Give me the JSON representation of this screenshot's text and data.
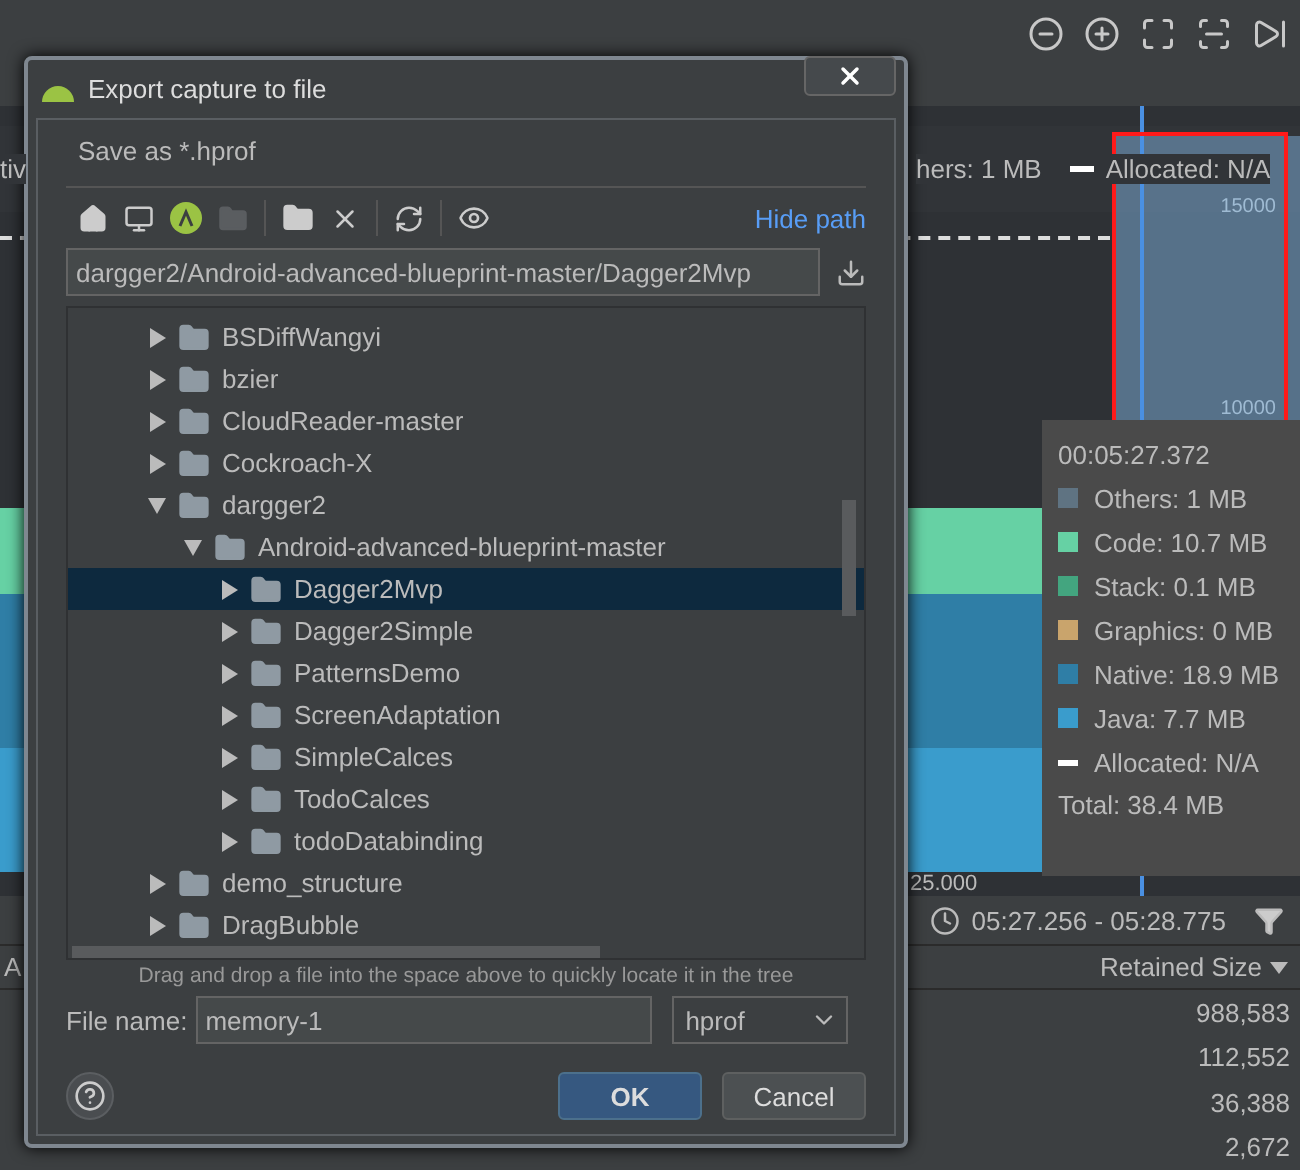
{
  "chart": {
    "legend": [
      "tiv",
      "hers: 1 MB",
      "Allocated: N/A"
    ],
    "y_labels": [
      "15000",
      "10000"
    ],
    "x_label": "25.000"
  },
  "tooltip": {
    "time": "00:05:27.372",
    "items": [
      {
        "label": "Others: 1 MB",
        "color": "#5f7382",
        "kind": "box"
      },
      {
        "label": "Code: 10.7 MB",
        "color": "#66d1a4",
        "kind": "box"
      },
      {
        "label": "Stack: 0.1 MB",
        "color": "#43a57f",
        "kind": "box"
      },
      {
        "label": "Graphics: 0 MB",
        "color": "#c9a46c",
        "kind": "box"
      },
      {
        "label": "Native: 18.9 MB",
        "color": "#2f7ea6",
        "kind": "box"
      },
      {
        "label": "Java: 7.7 MB",
        "color": "#3a9ccc",
        "kind": "box"
      },
      {
        "label": "Allocated: N/A",
        "color": "#ffffff",
        "kind": "dashed"
      }
    ],
    "total": "Total: 38.4 MB"
  },
  "time_range": "05:27.256 - 05:28.775",
  "table": {
    "columns": [
      {
        "label": "A"
      },
      {
        "label": "Retained Size",
        "sorted": true
      }
    ],
    "rows": [
      "988,583",
      "112,552",
      "36,388",
      "2,672"
    ]
  },
  "dialog": {
    "title": "Export capture to file",
    "save_as": "Save as *.hprof",
    "hide_path": "Hide path",
    "path": "dargger2/Android-advanced-blueprint-master/Dagger2Mvp",
    "tree": [
      {
        "label": "BSDiffWangyi",
        "expanded": false,
        "selected": false
      },
      {
        "label": "bzier",
        "expanded": false,
        "selected": false
      },
      {
        "label": "CloudReader-master",
        "expanded": false,
        "selected": false
      },
      {
        "label": "Cockroach-X",
        "expanded": false,
        "selected": false
      },
      {
        "label": "dargger2",
        "expanded": true,
        "selected": false,
        "children": [
          {
            "label": "Android-advanced-blueprint-master",
            "expanded": true,
            "selected": false,
            "children": [
              {
                "label": "Dagger2Mvp",
                "expanded": false,
                "selected": true
              },
              {
                "label": "Dagger2Simple",
                "expanded": false,
                "selected": false
              },
              {
                "label": "PatternsDemo",
                "expanded": false,
                "selected": false
              },
              {
                "label": "ScreenAdaptation",
                "expanded": false,
                "selected": false
              },
              {
                "label": "SimpleCalces",
                "expanded": false,
                "selected": false
              },
              {
                "label": "TodoCalces",
                "expanded": false,
                "selected": false
              },
              {
                "label": "todoDatabinding",
                "expanded": false,
                "selected": false
              }
            ]
          }
        ]
      },
      {
        "label": "demo_structure",
        "expanded": false,
        "selected": false
      },
      {
        "label": "DragBubble",
        "expanded": false,
        "selected": false
      }
    ],
    "hint": "Drag and drop a file into the space above to quickly locate it in the tree",
    "file_name_label": "File name:",
    "file_name": "memory-1",
    "format": "hprof",
    "buttons": [
      {
        "label": "OK",
        "kind": "primary"
      },
      {
        "label": "Cancel",
        "kind": "secondary"
      }
    ]
  }
}
